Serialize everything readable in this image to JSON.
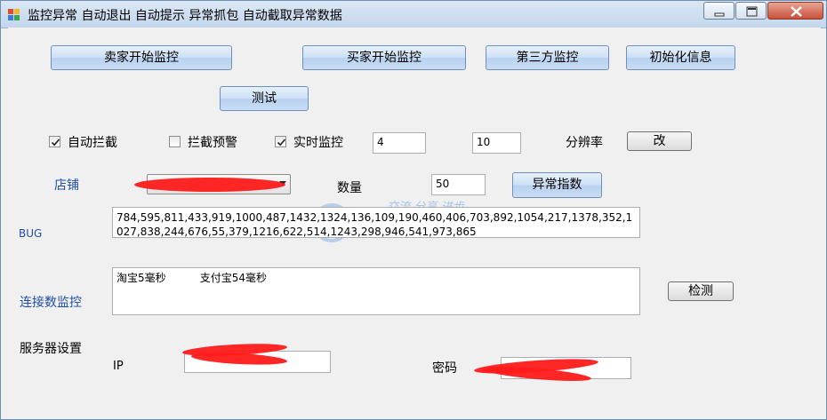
{
  "window": {
    "title": "监控异常 自动退出 自动提示 异常抓包 自动截取异常数据"
  },
  "buttons": {
    "seller_monitor": "卖家开始监控",
    "buyer_monitor": "买家开始监控",
    "third_party_monitor": "第三方监控",
    "init_info": "初始化信息",
    "test": "测试",
    "change": "改",
    "anomaly_index": "异常指数",
    "detect": "检测"
  },
  "options": {
    "auto_intercept": {
      "label": "自动拦截",
      "checked": true
    },
    "intercept_warning": {
      "label": "拦截预警",
      "checked": false
    },
    "realtime_monitor": {
      "label": "实时监控",
      "checked": true
    },
    "field_a_value": "4",
    "field_b_value": "10",
    "resolution_label": "分辨率"
  },
  "shop": {
    "label": "店铺",
    "quantity_label": "数量",
    "quantity_value": "50"
  },
  "bug": {
    "label": "BUG",
    "text": "784,595,811,433,919,1000,487,1432,1324,136,109,190,460,406,703,892,1054,217,1378,352,1027,838,244,676,55,379,1216,622,514,1243,298,946,541,973,865"
  },
  "connection": {
    "label": "连接数监控",
    "text": "淘宝5毫秒          支付宝54毫秒"
  },
  "server": {
    "section_label": "服务器设置",
    "ip_label": "IP",
    "password_label": "密码"
  },
  "watermark": {
    "text": "交流-分享-进步"
  },
  "colors": {
    "button_blue": "#c8dcf4",
    "label_blue": "#1f4ea8",
    "redaction": "#ff1a1a"
  }
}
